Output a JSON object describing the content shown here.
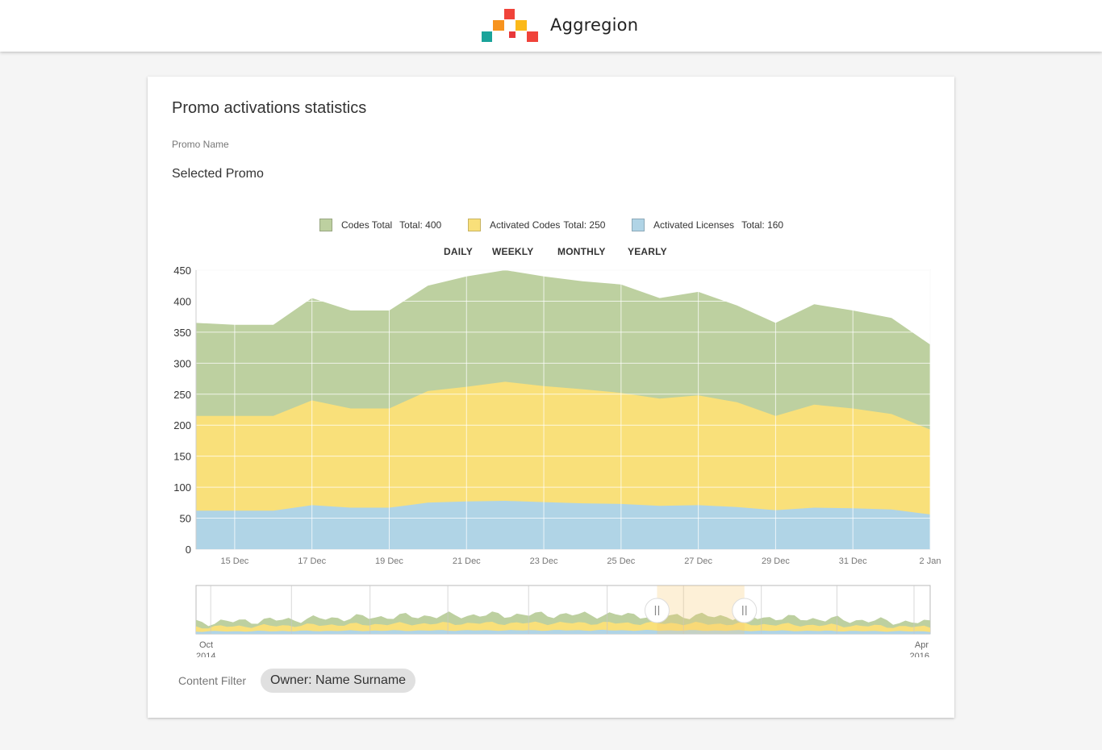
{
  "header": {
    "brand": "Aggregion"
  },
  "card": {
    "title": "Promo activations statistics",
    "promo_label": "Promo Name",
    "promo_value": "Selected Promo"
  },
  "legend": [
    {
      "name": "Codes Total",
      "total": "Total: 400",
      "color": "#bdd0a0"
    },
    {
      "name": "Activated Codes",
      "total": "Total: 250",
      "color": "#f9e07a"
    },
    {
      "name": "Activated Licenses",
      "total": "Total: 160",
      "color": "#b0d4e6"
    }
  ],
  "periods": [
    "DAILY",
    "WEEKLY",
    "MONTHLY",
    "YEARLY"
  ],
  "chart_data": {
    "type": "area",
    "x": [
      "14 Dec",
      "15 Dec",
      "16 Dec",
      "17 Dec",
      "18 Dec",
      "19 Dec",
      "20 Dec",
      "21 Dec",
      "22 Dec",
      "23 Dec",
      "24 Dec",
      "25 Dec",
      "26 Dec",
      "27 Dec",
      "28 Dec",
      "29 Dec",
      "30 Dec",
      "31 Dec",
      "1 Jan",
      "2 Jan"
    ],
    "x_tick_labels": [
      "15 Dec",
      "17 Dec",
      "19 Dec",
      "21 Dec",
      "23 Dec",
      "25 Dec",
      "27 Dec",
      "29 Dec",
      "31 Dec",
      "2 Jan"
    ],
    "y_ticks": [
      0,
      50,
      100,
      150,
      200,
      250,
      300,
      350,
      400,
      450
    ],
    "ylim": [
      0,
      450
    ],
    "series": [
      {
        "name": "Codes Total",
        "color": "#bdd0a0",
        "values": [
          365,
          362,
          362,
          405,
          385,
          385,
          425,
          440,
          450,
          440,
          432,
          427,
          405,
          415,
          393,
          365,
          395,
          385,
          373,
          330
        ]
      },
      {
        "name": "Activated Codes",
        "color": "#f9e07a",
        "values": [
          215,
          215,
          215,
          240,
          227,
          227,
          255,
          262,
          270,
          263,
          258,
          252,
          243,
          248,
          237,
          215,
          233,
          227,
          218,
          193
        ]
      },
      {
        "name": "Activated Licenses",
        "color": "#b0d4e6",
        "values": [
          62,
          62,
          62,
          71,
          67,
          67,
          75,
          77,
          78,
          76,
          74,
          73,
          70,
          71,
          68,
          63,
          67,
          66,
          64,
          56
        ]
      }
    ],
    "grid": true
  },
  "navigator": {
    "start_label": "Oct",
    "start_year": "2014",
    "end_label": "Apr",
    "end_year": "2016",
    "selection": [
      0.628,
      0.747
    ]
  },
  "filter": {
    "label": "Content Filter",
    "chip": "Owner: Name Surname"
  }
}
